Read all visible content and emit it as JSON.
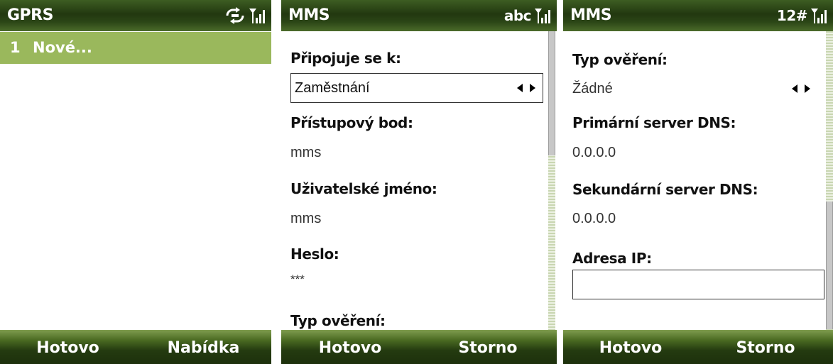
{
  "screens": [
    {
      "title": "GPRS",
      "status_icons": [
        "data-connection-icon",
        "signal-strength-icon"
      ],
      "list": [
        {
          "number": "1",
          "label": "Nové..."
        }
      ],
      "softkeys": {
        "left": "Hotovo",
        "right": "Nabídka"
      }
    },
    {
      "title": "MMS",
      "input_mode": "abc",
      "status_icons": [
        "signal-strength-icon"
      ],
      "fields": {
        "connects_to_label": "Připojuje se k:",
        "connects_to_value": "Zaměstnání",
        "access_point_label": "Přístupový bod:",
        "access_point_value": "mms",
        "username_label": "Uživatelské jméno:",
        "username_value": "mms",
        "password_label": "Heslo:",
        "password_value": "***",
        "auth_type_label": "Typ ověření:"
      },
      "softkeys": {
        "left": "Hotovo",
        "right": "Storno"
      }
    },
    {
      "title": "MMS",
      "input_mode": "12#",
      "status_icons": [
        "signal-strength-icon"
      ],
      "fields": {
        "auth_type_label": "Typ ověření:",
        "auth_type_value": "Žádné",
        "primary_dns_label": "Primární server DNS:",
        "primary_dns_value": "0.0.0.0",
        "secondary_dns_label": "Sekundární server DNS:",
        "secondary_dns_value": "0.0.0.0",
        "ip_address_label": "Adresa IP:",
        "ip_address_value": ""
      },
      "softkeys": {
        "left": "Hotovo",
        "right": "Storno"
      }
    }
  ],
  "colors": {
    "titlebar": "#2b4516",
    "selection": "#9ab85c",
    "softbar": "#243b10",
    "text": "#111111"
  }
}
